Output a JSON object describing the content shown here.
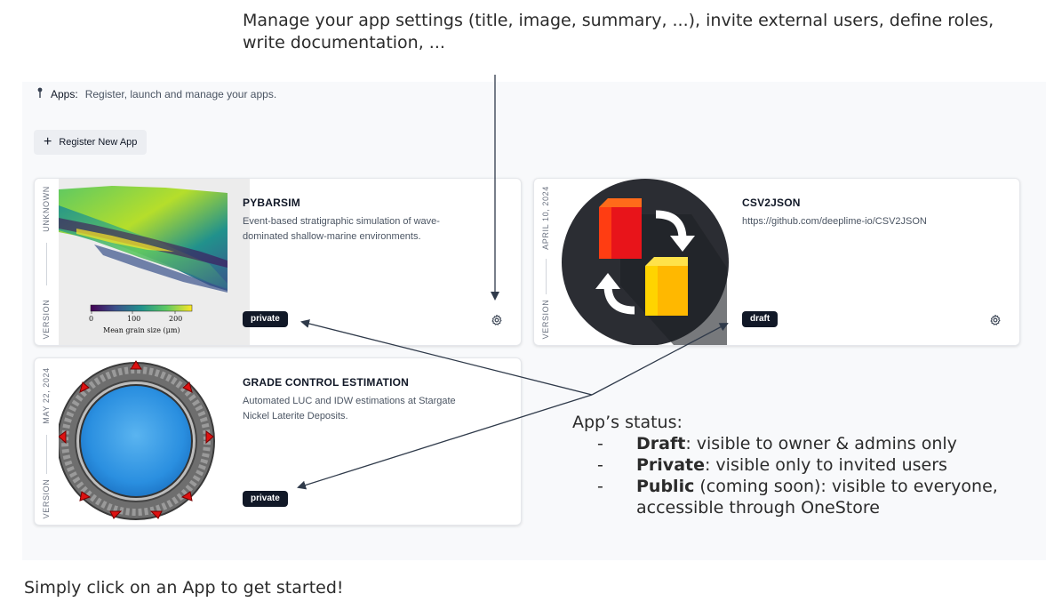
{
  "annotations": {
    "top": "Manage your app settings (title, image, summary, ...), invite external users, define roles, write documentation, ...",
    "status_heading": "App’s status:",
    "status_items": [
      {
        "dash": "-",
        "name": "Draft",
        "text": ": visible to owner & admins only"
      },
      {
        "dash": "-",
        "name": "Private",
        "text": ": visible only to invited users"
      },
      {
        "dash": "-",
        "name": "Public",
        "text": " (coming soon): visible to everyone, accessible through OneStore"
      }
    ],
    "bottom": "Simply click on an App to get started!"
  },
  "header": {
    "icon": "pin-icon",
    "label": "Apps:",
    "description": "Register, launch and manage your apps."
  },
  "register_button": {
    "icon": "plus-icon",
    "label": "Register New App"
  },
  "apps": [
    {
      "title": "PYBARSIM",
      "description": "Event-based stratigraphic simulation of wave-dominated shallow-marine environments.",
      "date": "UNKNOWN",
      "version_label": "VERSION",
      "status": "private",
      "thumbnail": {
        "colorbar_ticks": [
          "0",
          "100",
          "200"
        ],
        "colorbar_label": "Mean grain size (μm)"
      }
    },
    {
      "title": "CSV2JSON",
      "description": "https://github.com/deeplime-io/CSV2JSON",
      "date": "APRIL 10, 2024",
      "version_label": "VERSION",
      "status": "draft"
    },
    {
      "title": "GRADE CONTROL ESTIMATION",
      "description": "Automated LUC and IDW estimations at Stargate Nickel Laterite Deposits.",
      "date": "MAY 22, 2024",
      "version_label": "VERSION",
      "status": "private"
    }
  ],
  "colors": {
    "badge_bg": "#111827",
    "panel_bg": "#f8f9fb",
    "arrow": "#2f3a4a"
  }
}
